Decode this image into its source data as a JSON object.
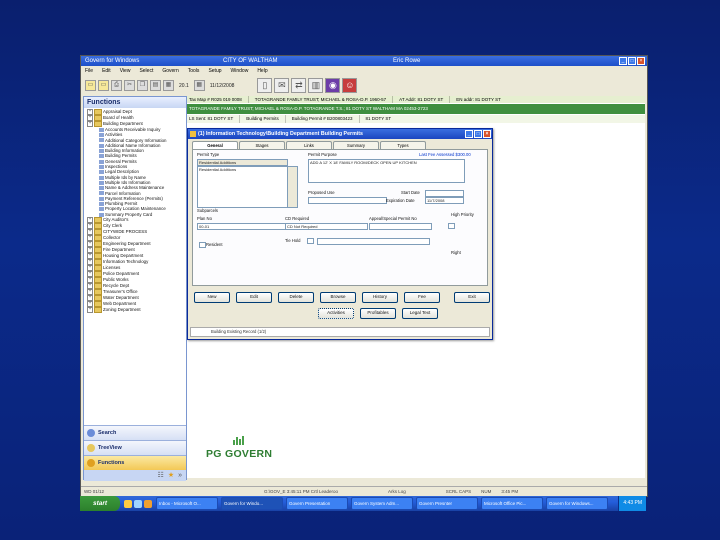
{
  "window": {
    "title_left": "Govern for Windows",
    "title_center": "CITY OF WALTHAM",
    "title_right": "Eric Rowe"
  },
  "menu": [
    "File",
    "Edit",
    "View",
    "Select",
    "Govern",
    "Tools",
    "Setup",
    "Window",
    "Help"
  ],
  "toolbar": {
    "page_num": "20.1",
    "date": "11/12/2008"
  },
  "functions": {
    "header": "Functions",
    "tree": [
      {
        "label": "Appraisal Dept",
        "type": "folder"
      },
      {
        "label": "Board of Health",
        "type": "folder"
      },
      {
        "label": "Building Department",
        "type": "folder"
      },
      {
        "label": "Accounts Receivable Inquiry",
        "type": "sub"
      },
      {
        "label": "Activities",
        "type": "sub"
      },
      {
        "label": "Additional Category Information",
        "type": "sub"
      },
      {
        "label": "Additional Name Information",
        "type": "sub"
      },
      {
        "label": "Building Information",
        "type": "sub"
      },
      {
        "label": "Building Permits",
        "type": "sub"
      },
      {
        "label": "General Permits",
        "type": "sub"
      },
      {
        "label": "Inspections",
        "type": "sub"
      },
      {
        "label": "Legal Description",
        "type": "sub"
      },
      {
        "label": "Multiple Ids by Name",
        "type": "sub"
      },
      {
        "label": "Multiple Ids Information",
        "type": "sub"
      },
      {
        "label": "Name & Address Maintenance",
        "type": "sub"
      },
      {
        "label": "Parcel Information",
        "type": "sub"
      },
      {
        "label": "Payment Reference (Permits)",
        "type": "sub"
      },
      {
        "label": "Plumbing Permit",
        "type": "sub"
      },
      {
        "label": "Property Location Maintenance",
        "type": "sub"
      },
      {
        "label": "Summary Property Card",
        "type": "sub"
      },
      {
        "label": "City Auditor's",
        "type": "folder"
      },
      {
        "label": "City Clerk",
        "type": "folder"
      },
      {
        "label": "CITYWIDE PROCESS",
        "type": "folder"
      },
      {
        "label": "Collector",
        "type": "folder"
      },
      {
        "label": "Engineering Department",
        "type": "folder"
      },
      {
        "label": "Fire Department",
        "type": "folder"
      },
      {
        "label": "Housing Department",
        "type": "folder"
      },
      {
        "label": "Information Technology",
        "type": "folder"
      },
      {
        "label": "Licenses",
        "type": "folder"
      },
      {
        "label": "Police Department",
        "type": "folder"
      },
      {
        "label": "Public Works",
        "type": "folder"
      },
      {
        "label": "Recycle Dept",
        "type": "folder"
      },
      {
        "label": "Treasurer's Office",
        "type": "folder"
      },
      {
        "label": "Water Department",
        "type": "folder"
      },
      {
        "label": "Web Department",
        "type": "folder"
      },
      {
        "label": "Zoning Department",
        "type": "folder"
      }
    ],
    "nav": [
      "Search",
      "TreeView",
      "Functions"
    ]
  },
  "recordbar": {
    "row1": [
      "Tax Map # R025 019 0008",
      "TOTAGRANDE FAMILY TRUST; MICHAEL & ROSA-D.P. 1960-57",
      "AT Addr: 81 DOTY ST",
      "EN addr: 81 DOTY ST"
    ],
    "row2": "TOTAGRANDE FAMILY TRUST; MICHAEL & ROSA-D.P. TOTAGRANDE T.S.; 81 DOTY ST  WALTHAM MA 02453-2723",
    "row3": [
      "LS Sent: 81 DOTY ST",
      "Building Permits",
      "Building Permit # B200803423",
      "81 DOTY ST"
    ]
  },
  "logo": {
    "name": "PG GOVERN"
  },
  "statusbar": [
    "WD 01/12",
    "G:\\GOV_E 3:45:11 PM Crtl Leaderoo",
    "Arks Log",
    "SCRL CAPS",
    "NUM",
    "3:45 PM"
  ],
  "dialog": {
    "title": "(1) Information Technology\\Building Department Building Permits",
    "tabs": [
      "General",
      "Stages",
      "Links",
      "Summary",
      "Types"
    ],
    "active_tab": "General",
    "fields": {
      "permit_type_label": "Permit Type",
      "permit_type_value": "Residential Additions",
      "permit_type_detail": "Residential Additions",
      "permit_purpose_label": "Permit Purpose",
      "permit_purpose_value": "ADD A 12' X 18' FAMILY ROOM/DECK OPEN UP KITCHEN",
      "last_fee_assessed": "Last Fee Assessed $300.00",
      "proposed_use_label": "Proposed Use",
      "start_date_label": "Start Date",
      "expiration_date_label": "Expiration Date",
      "expiration_date_value": "11/7/2008",
      "subparcels_label": "Subparcels",
      "plan_no_label": "Plan No",
      "plan_no_value": "00-01",
      "cd_required_label": "CD Required",
      "cd_required_value": "CD Not Required",
      "appeal_label": "Appeal/Special Permit No",
      "high_priority_label": "High Priority",
      "resident_label": "Resident",
      "tie_hold_label": "Tie Hold",
      "right_label": "Right"
    },
    "buttons": [
      "New",
      "Edit",
      "Delete",
      "Browse",
      "History",
      "Fee"
    ],
    "exit_button": "Exit",
    "buttons_row2": [
      "Activities",
      "Profitables",
      "Legal Text"
    ],
    "status": "Building Existing Record (1/2)"
  },
  "taskbar": {
    "start": "start",
    "tasks": [
      "Inbox - Microsoft O...",
      "Govern for Windo...",
      "Govern Presentation",
      "Govern System Adm...",
      "Govern Presnter",
      "Microsoft Office Pic...",
      "Govern for Windows..."
    ],
    "active_task": 1,
    "clock": "4:43 PM"
  }
}
